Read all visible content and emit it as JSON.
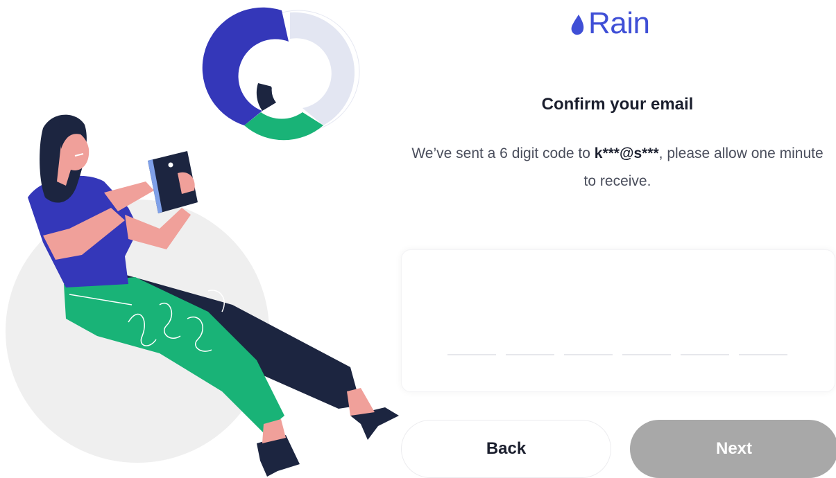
{
  "brand": {
    "name": "Rain",
    "color": "#3f4fd6"
  },
  "confirm": {
    "title": "Confirm your email",
    "description_prefix": "We’ve sent a 6 digit code to ",
    "masked_email": "k***@s***",
    "description_suffix": ", please allow one minute to receive."
  },
  "code_input": {
    "digits": [
      "",
      "",
      "",
      "",
      "",
      ""
    ]
  },
  "buttons": {
    "back_label": "Back",
    "next_label": "Next",
    "next_state": "disabled"
  },
  "colors": {
    "accent_blue": "#3f4fd6",
    "disabled_gray": "#a8a8a8",
    "illustration_green": "#19b377",
    "illustration_navy": "#1c2540"
  }
}
